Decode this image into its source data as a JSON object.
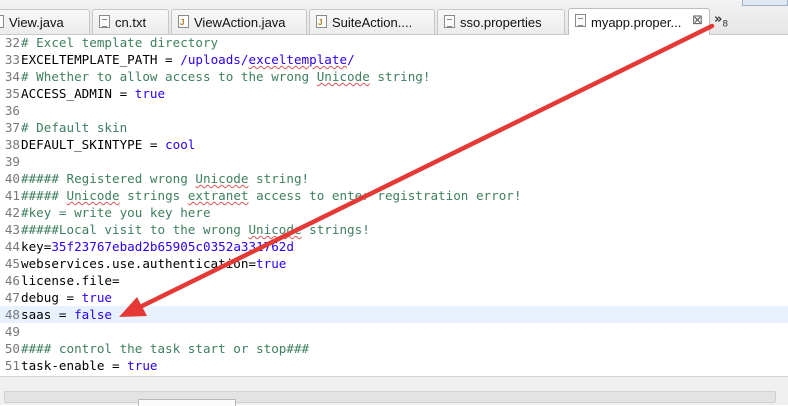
{
  "tabs": [
    {
      "label": "View.java",
      "icon": "java-file-icon"
    },
    {
      "label": "cn.txt",
      "icon": "text-file-icon"
    },
    {
      "label": "ViewAction.java",
      "icon": "java-file-icon"
    },
    {
      "label": "SuiteAction....",
      "icon": "java-file-icon"
    },
    {
      "label": "sso.properties",
      "icon": "properties-file-icon"
    },
    {
      "label": "myapp.proper...",
      "icon": "properties-file-icon",
      "active": true,
      "close": "⊠"
    }
  ],
  "overflow": {
    "label": "»",
    "count": "8"
  },
  "lines": [
    {
      "n": "32",
      "parts": [
        {
          "t": "# Excel template directory",
          "c": "cmt"
        }
      ]
    },
    {
      "n": "33",
      "parts": [
        {
          "t": "EXCELTEMPLATE_PATH = ",
          "c": ""
        },
        {
          "t": "/uploads/",
          "c": "val"
        },
        {
          "t": "exceltemplate",
          "c": "val sq"
        },
        {
          "t": "/",
          "c": "val"
        }
      ]
    },
    {
      "n": "34",
      "parts": [
        {
          "t": "# Whether to allow access to the wrong ",
          "c": "cmt"
        },
        {
          "t": "Unicode",
          "c": "cmt sq"
        },
        {
          "t": " string!",
          "c": "cmt"
        }
      ]
    },
    {
      "n": "35",
      "parts": [
        {
          "t": "ACCESS_ADMIN = ",
          "c": ""
        },
        {
          "t": "true",
          "c": "val"
        }
      ]
    },
    {
      "n": "36",
      "parts": []
    },
    {
      "n": "37",
      "parts": [
        {
          "t": "# Default skin",
          "c": "cmt"
        }
      ]
    },
    {
      "n": "38",
      "parts": [
        {
          "t": "DEFAULT_SKINTYPE = ",
          "c": ""
        },
        {
          "t": "cool",
          "c": "val"
        }
      ]
    },
    {
      "n": "39",
      "parts": []
    },
    {
      "n": "40",
      "parts": [
        {
          "t": "##### Registered wrong ",
          "c": "cmt"
        },
        {
          "t": "Unicode",
          "c": "cmt sq"
        },
        {
          "t": " string!",
          "c": "cmt"
        }
      ]
    },
    {
      "n": "41",
      "parts": [
        {
          "t": "##### ",
          "c": "cmt"
        },
        {
          "t": "Unicode",
          "c": "cmt sq"
        },
        {
          "t": " strings ",
          "c": "cmt"
        },
        {
          "t": "extranet",
          "c": "cmt sq"
        },
        {
          "t": " access to enter registration error!",
          "c": "cmt"
        }
      ]
    },
    {
      "n": "42",
      "parts": [
        {
          "t": "#key = write you key here",
          "c": "cmt"
        }
      ]
    },
    {
      "n": "43",
      "parts": [
        {
          "t": "#####Local visit to the wrong ",
          "c": "cmt"
        },
        {
          "t": "Unicode",
          "c": "cmt sq"
        },
        {
          "t": " strings!",
          "c": "cmt"
        }
      ]
    },
    {
      "n": "44",
      "parts": [
        {
          "t": "key=",
          "c": ""
        },
        {
          "t": "35f23767ebad2b65905c0352a331762d",
          "c": "val"
        }
      ]
    },
    {
      "n": "45",
      "parts": [
        {
          "t": "webservices.use.authentication=",
          "c": ""
        },
        {
          "t": "true",
          "c": "val"
        }
      ]
    },
    {
      "n": "46",
      "parts": [
        {
          "t": "license.file=",
          "c": ""
        }
      ]
    },
    {
      "n": "47",
      "parts": [
        {
          "t": "debug = ",
          "c": ""
        },
        {
          "t": "true",
          "c": "val"
        }
      ]
    },
    {
      "n": "48",
      "parts": [
        {
          "t": "saas = ",
          "c": ""
        },
        {
          "t": "false",
          "c": "val"
        }
      ],
      "current": true
    },
    {
      "n": "49",
      "parts": []
    },
    {
      "n": "50",
      "parts": [
        {
          "t": "#### control the task start or stop###",
          "c": "cmt"
        }
      ]
    },
    {
      "n": "51",
      "parts": [
        {
          "t": "task-enable = ",
          "c": ""
        },
        {
          "t": "true",
          "c": "val"
        }
      ]
    }
  ],
  "colors": {
    "comment": "#3f7f5f",
    "value": "#2a00ff",
    "arrow": "#e53935",
    "current_line": "#e8f2fe"
  }
}
